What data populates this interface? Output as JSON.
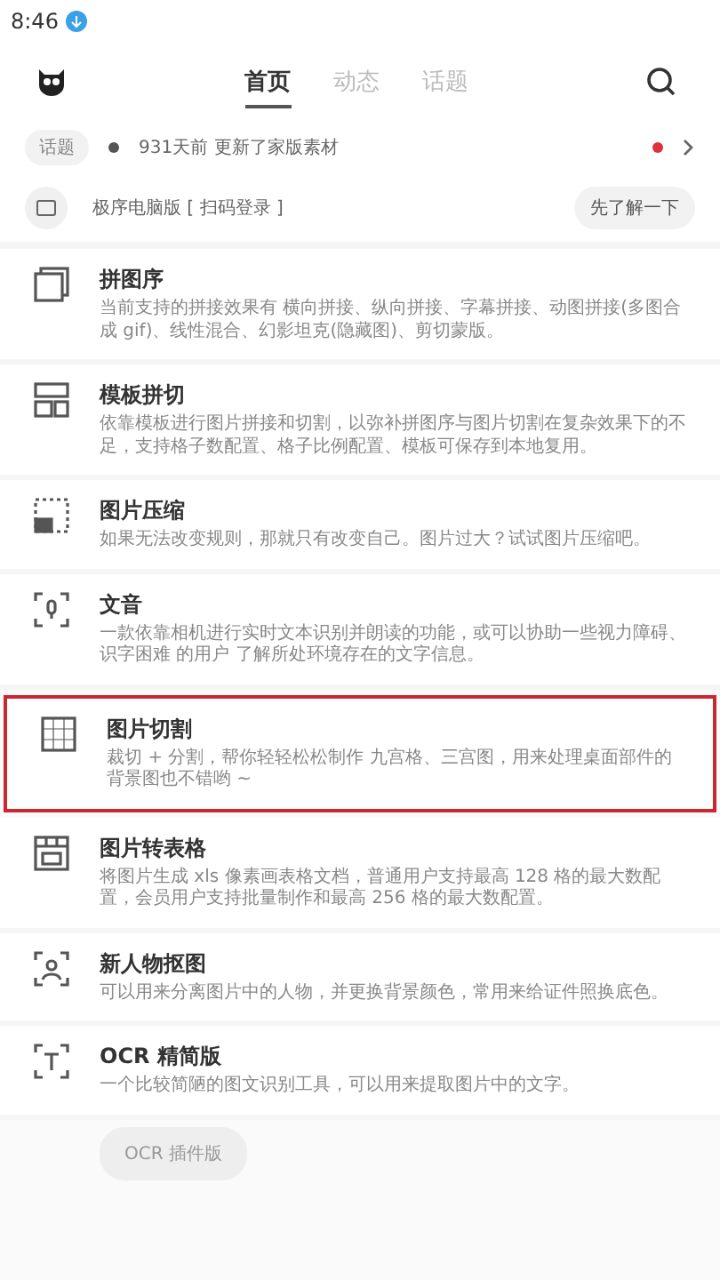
{
  "status_bar": {
    "time": "8:46"
  },
  "tabs": [
    {
      "label": "首页",
      "selected": true
    },
    {
      "label": "动态",
      "selected": false
    },
    {
      "label": "话题",
      "selected": false
    }
  ],
  "notice": {
    "tag": "话题",
    "text": "931天前 更新了家版素材",
    "unread": true
  },
  "pc_banner": {
    "text": "极序电脑版 [ 扫码登录 ]",
    "button": "先了解一下"
  },
  "tools": [
    {
      "kind": "stack",
      "title": "拼图序",
      "description": "当前支持的拼接效果有 横向拼接、纵向拼接、字幕拼接、动图拼接(多图合成 gif)、线性混合、幻影坦克(隐藏图)、剪切蒙版。",
      "selected": false
    },
    {
      "kind": "template",
      "title": "模板拼切",
      "description": "依靠模板进行图片拼接和切割，以弥补拼图序与图片切割在复杂效果下的不足，支持格子数配置、格子比例配置、模板可保存到本地复用。",
      "selected": false
    },
    {
      "kind": "compress",
      "title": "图片压缩",
      "description": "如果无法改变规则，那就只有改变自己。图片过大？试试图片压缩吧。",
      "selected": false
    },
    {
      "kind": "voice",
      "title": "文音",
      "description": "一款依靠相机进行实时文本识别并朗读的功能，或可以协助一些视力障碍、识字困难 的用户 了解所处环境存在的文字信息。",
      "selected": false
    },
    {
      "kind": "grid",
      "title": "图片切割",
      "description": "裁切 + 分割，帮你轻轻松松制作 九宫格、三宫图，用来处理桌面部件的背景图也不错哟 ~",
      "selected": true
    },
    {
      "kind": "table",
      "title": "图片转表格",
      "description": "将图片生成 xls 像素画表格文档，普通用户支持最高 128 格的最大数配置，会员用户支持批量制作和最高 256 格的最大数配置。",
      "selected": false
    },
    {
      "kind": "person",
      "title": "新人物抠图",
      "description": "可以用来分离图片中的人物，并更换背景颜色，常用来给证件照换底色。",
      "selected": false
    },
    {
      "kind": "ocr",
      "title": "OCR 精简版",
      "description": "一个比较简陋的图文识别工具，可以用来提取图片中的文字。",
      "selected": false
    }
  ],
  "plugin_button": "OCR 插件版"
}
